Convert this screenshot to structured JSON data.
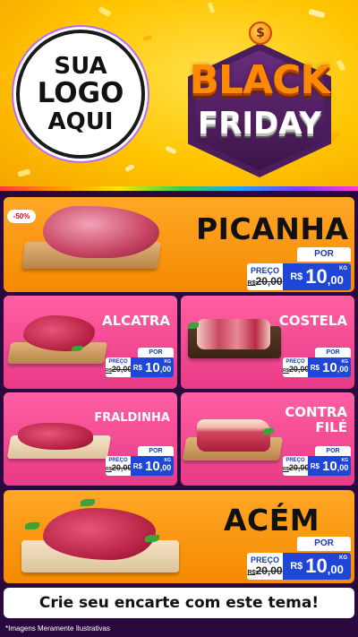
{
  "header": {
    "logo_line1": "SUA",
    "logo_line2": "LOGO",
    "logo_line3": "AQUI",
    "badge_coin": "$",
    "badge_line1": "BLACK",
    "badge_line2": "FRIDAY"
  },
  "products": {
    "picanha": {
      "name": "PICANHA",
      "discount": "-50%",
      "por": "POR",
      "preco_label": "PREÇO",
      "old_price": "20,00",
      "currency": "R$",
      "price_int": "10",
      "price_dec": ",00",
      "unit": "KG"
    },
    "alcatra": {
      "name": "ALCATRA",
      "por": "POR",
      "preco_label": "PREÇO",
      "old_price": "20,00",
      "currency": "R$",
      "price_int": "10",
      "price_dec": ",00",
      "unit": "KG"
    },
    "costela": {
      "name": "COSTELA",
      "por": "POR",
      "preco_label": "PREÇO",
      "old_price": "20,00",
      "currency": "R$",
      "price_int": "10",
      "price_dec": ",00",
      "unit": "KG"
    },
    "fraldinha": {
      "name": "FRALDINHA",
      "por": "POR",
      "preco_label": "PREÇO",
      "old_price": "20,00",
      "currency": "R$",
      "price_int": "10",
      "price_dec": ",00",
      "unit": "KG"
    },
    "contrafile": {
      "name_line1": "CONTRA",
      "name_line2": "FILÉ",
      "por": "POR",
      "preco_label": "PREÇO",
      "old_price": "20,00",
      "currency": "R$",
      "price_int": "10",
      "price_dec": ",00",
      "unit": "KG"
    },
    "acem": {
      "name": "ACÉM",
      "por": "POR",
      "preco_label": "PREÇO",
      "old_price": "20,00",
      "currency": "R$",
      "price_int": "10",
      "price_dec": ",00",
      "unit": "KG"
    }
  },
  "footer": {
    "cta": "Crie seu encarte com este tema!",
    "disclaimer": "*Imagens Meramente Ilustrativas"
  },
  "colors": {
    "header_bg": "#ffc400",
    "orange_card": "#f58a00",
    "pink_card": "#e83a86",
    "price_blue": "#1f46d6",
    "page_bg": "#2a0a3e"
  }
}
